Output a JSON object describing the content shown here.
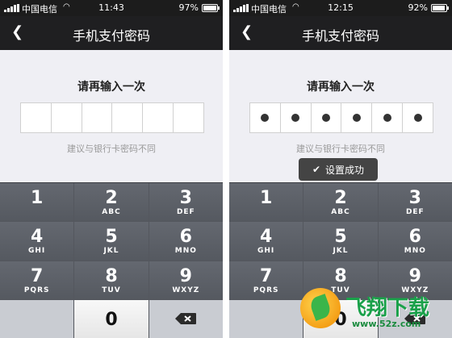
{
  "screens": [
    {
      "status": {
        "carrier": "中国电信",
        "time": "11:43",
        "battery": "97%",
        "battery_level": 0.97
      },
      "nav": {
        "title": "手机支付密码"
      },
      "prompt": "请再输入一次",
      "pin_filled": 0,
      "hint": "建议与银行卡密码不同",
      "toast": null
    },
    {
      "status": {
        "carrier": "中国电信",
        "time": "12:15",
        "battery": "92%",
        "battery_level": 0.92
      },
      "nav": {
        "title": "手机支付密码"
      },
      "prompt": "请再输入一次",
      "pin_filled": 6,
      "hint": "建议与银行卡密码不同",
      "toast": "设置成功"
    }
  ],
  "keypad": [
    {
      "num": "1",
      "sub": ""
    },
    {
      "num": "2",
      "sub": "ABC"
    },
    {
      "num": "3",
      "sub": "DEF"
    },
    {
      "num": "4",
      "sub": "GHI"
    },
    {
      "num": "5",
      "sub": "JKL"
    },
    {
      "num": "6",
      "sub": "MNO"
    },
    {
      "num": "7",
      "sub": "PQRS"
    },
    {
      "num": "8",
      "sub": "TUV"
    },
    {
      "num": "9",
      "sub": "WXYZ"
    },
    {
      "num": "",
      "sub": "",
      "type": "blank"
    },
    {
      "num": "0",
      "sub": "",
      "type": "zero"
    },
    {
      "num": "",
      "sub": "",
      "type": "delete",
      "icon": "backspace-icon"
    }
  ],
  "watermark": {
    "brand": "飞翔下载",
    "url": "www.52z.com"
  },
  "colors": {
    "navbar": "#1f1f21",
    "keypad": "#54575e",
    "brand_green": "#1aa14a"
  }
}
